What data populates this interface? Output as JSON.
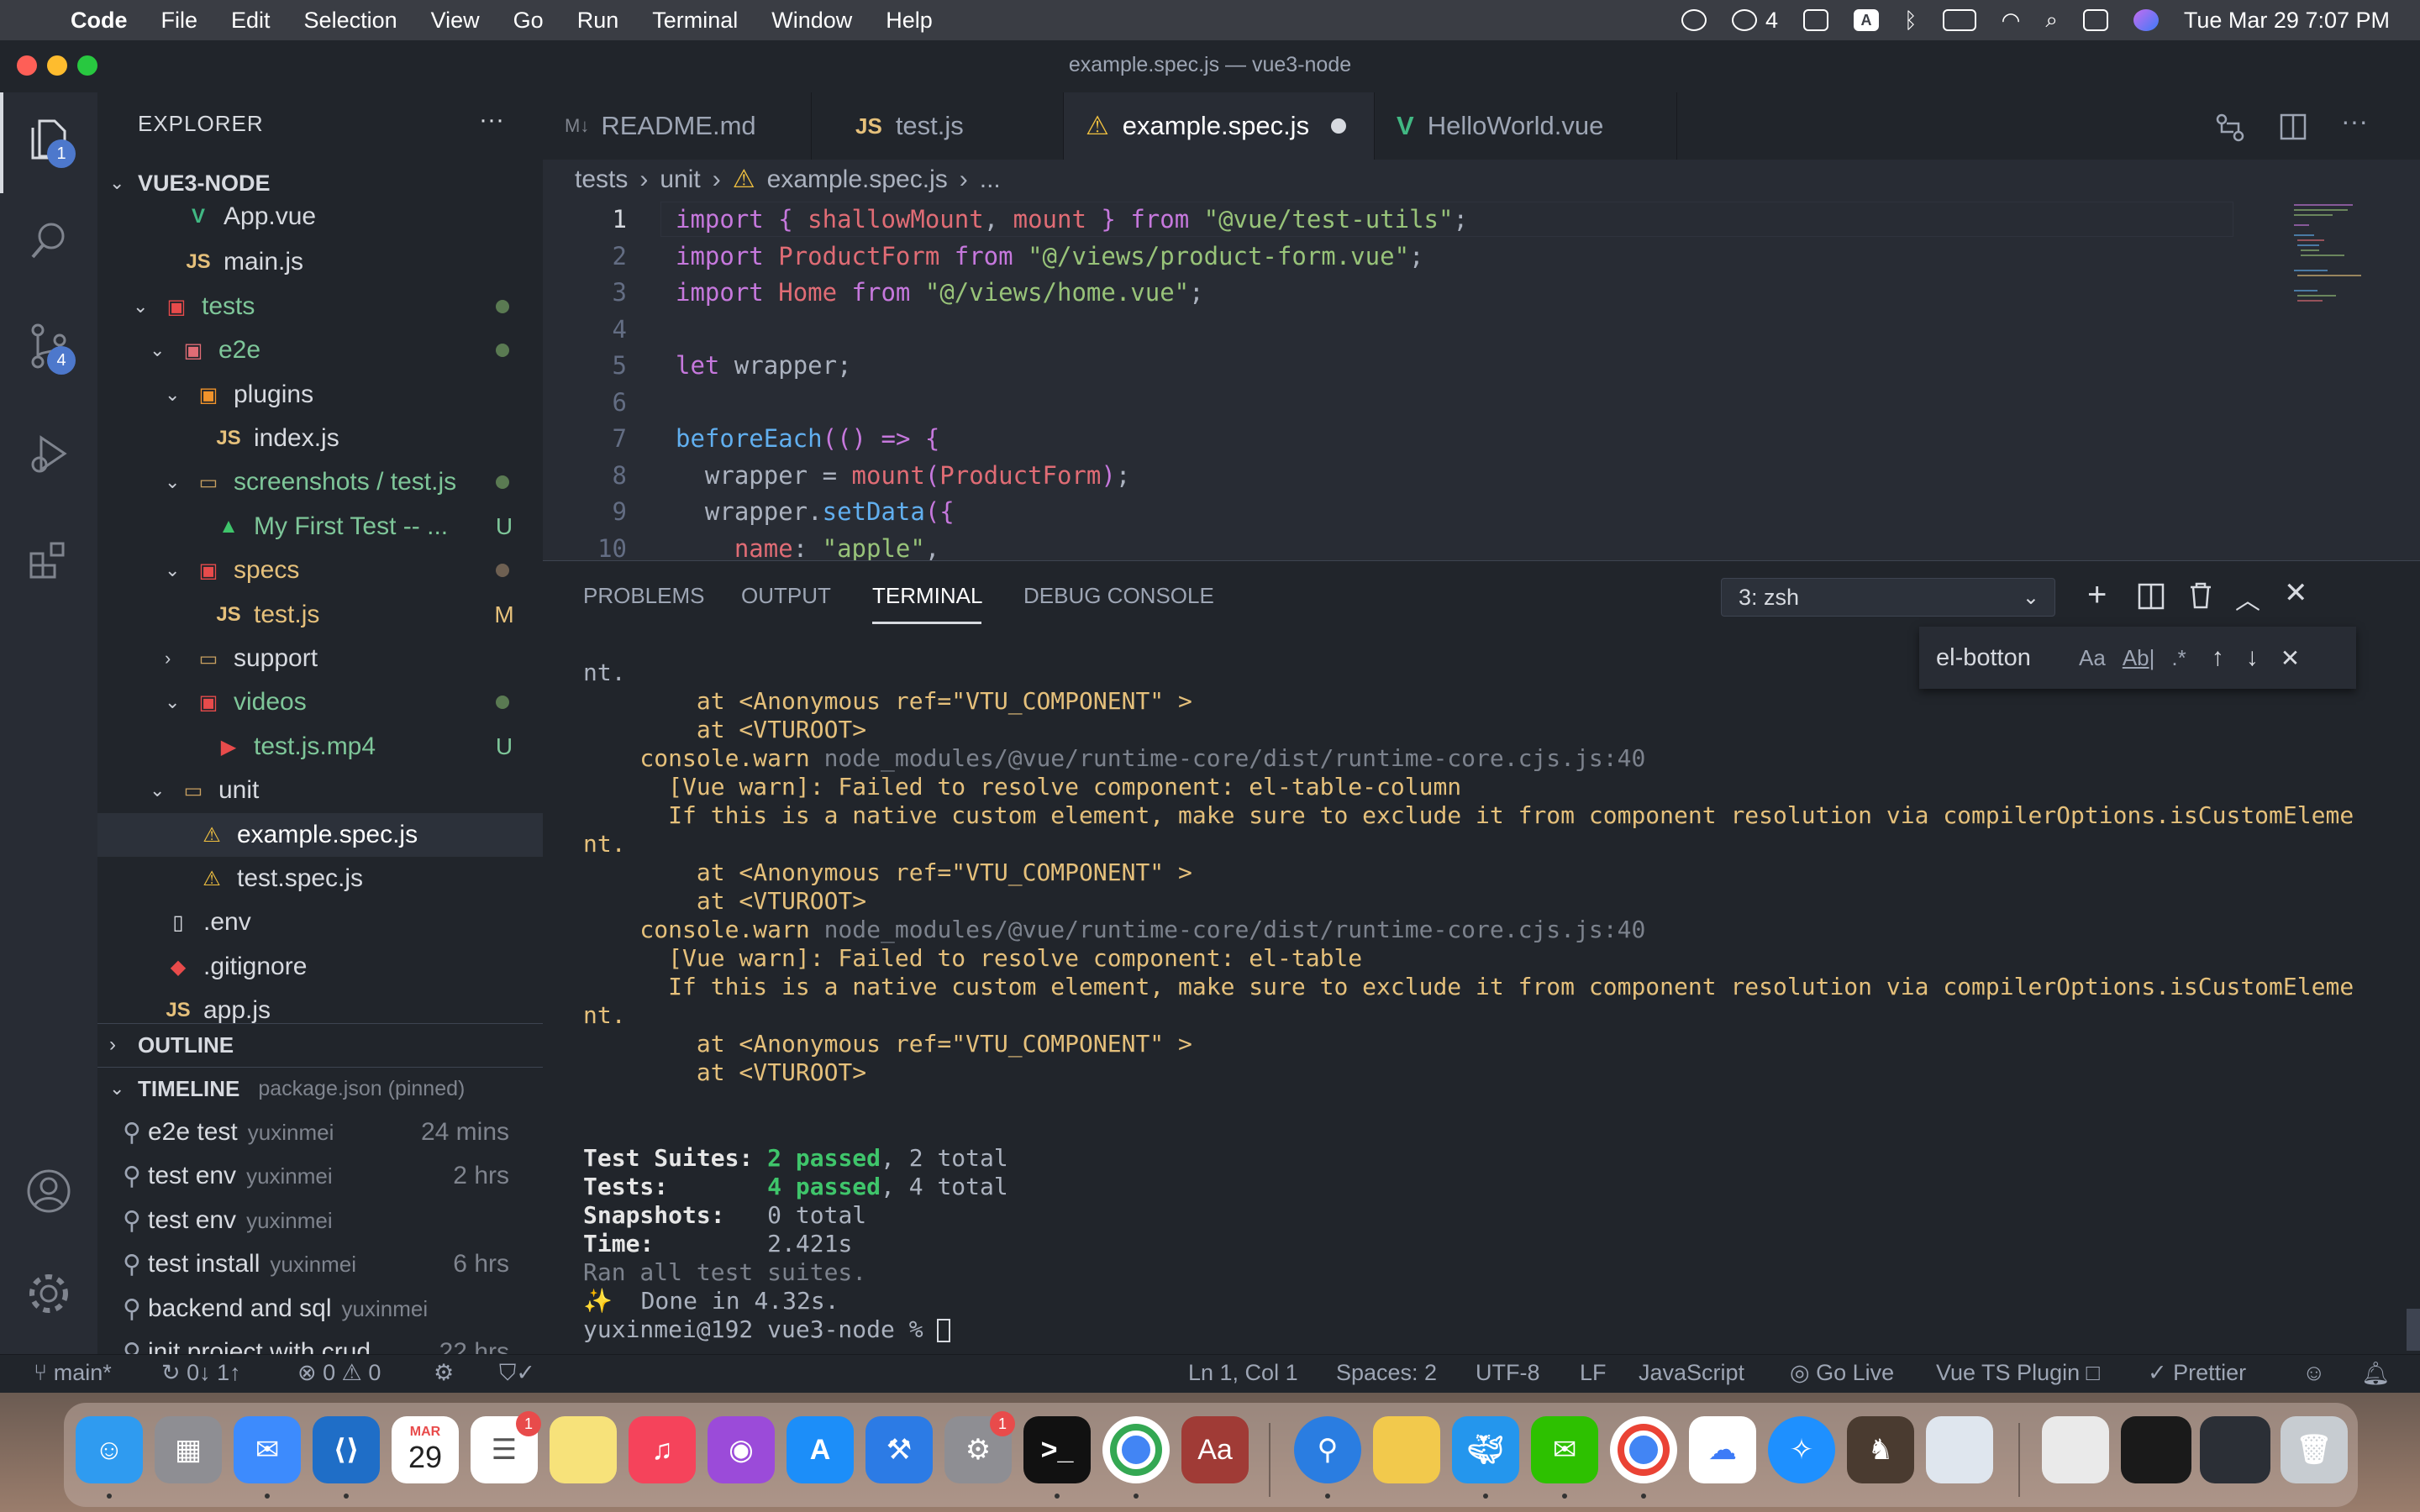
{
  "menubar": {
    "app": "Code",
    "items": [
      "File",
      "Edit",
      "Selection",
      "View",
      "Go",
      "Run",
      "Terminal",
      "Window",
      "Help"
    ],
    "wechat_count": "4",
    "input_source": "A",
    "datetime": "Tue Mar 29  7:07 PM"
  },
  "window": {
    "title": "example.spec.js — vue3-node"
  },
  "activity": {
    "explorer_badge": "1",
    "scm_badge": "4"
  },
  "sidebar": {
    "title": "EXPLORER",
    "more": "···",
    "project": "VUE3-NODE",
    "rows": [
      {
        "name": "App.vue",
        "icon": "V",
        "status": ""
      },
      {
        "name": "main.js",
        "icon": "JS",
        "status": ""
      },
      {
        "name": "tests",
        "icon": "▣",
        "status": "●"
      },
      {
        "name": "e2e",
        "icon": "▣",
        "status": "●"
      },
      {
        "name": "plugins",
        "icon": "▣",
        "status": ""
      },
      {
        "name": "index.js",
        "icon": "JS",
        "status": ""
      },
      {
        "name": "screenshots / test.js",
        "icon": "▭",
        "status": "●"
      },
      {
        "name": "My First Test -- ...",
        "icon": "▲",
        "status": "U"
      },
      {
        "name": "specs",
        "icon": "▣",
        "status": "●"
      },
      {
        "name": "test.js",
        "icon": "JS",
        "status": "M"
      },
      {
        "name": "support",
        "icon": "▭",
        "status": ""
      },
      {
        "name": "videos",
        "icon": "▣",
        "status": "●"
      },
      {
        "name": "test.js.mp4",
        "icon": "▶",
        "status": "U"
      },
      {
        "name": "unit",
        "icon": "▭",
        "status": ""
      },
      {
        "name": "example.spec.js",
        "icon": "⚠",
        "status": ""
      },
      {
        "name": "test.spec.js",
        "icon": "⚠",
        "status": ""
      },
      {
        "name": ".env",
        "icon": "▯",
        "status": ""
      },
      {
        "name": ".gitignore",
        "icon": "◆",
        "status": ""
      },
      {
        "name": "app.js",
        "icon": "JS",
        "status": ""
      }
    ],
    "outline": "OUTLINE",
    "timeline": "TIMELINE",
    "timeline_pin": "package.json (pinned)",
    "timeline_items": [
      {
        "msg": "e2e test",
        "author": "yuxinmei",
        "time": "24 mins"
      },
      {
        "msg": "test env",
        "author": "yuxinmei",
        "time": "2 hrs"
      },
      {
        "msg": "test env",
        "author": "yuxinmei",
        "time": ""
      },
      {
        "msg": "test install",
        "author": "yuxinmei",
        "time": "6 hrs"
      },
      {
        "msg": "backend and sql",
        "author": "yuxinmei",
        "time": ""
      },
      {
        "msg": "init project with crud",
        "author": "",
        "time": "22 hrs"
      }
    ]
  },
  "tabs": [
    {
      "label": "README.md",
      "icon": "M↓"
    },
    {
      "label": "test.js",
      "icon": "JS"
    },
    {
      "label": "example.spec.js",
      "icon": "⚠"
    },
    {
      "label": "HelloWorld.vue",
      "icon": "V"
    }
  ],
  "breadcrumb": [
    "tests",
    "unit",
    "example.spec.js",
    "..."
  ],
  "editor": {
    "line_numbers": [
      "1",
      "2",
      "3",
      "4",
      "5",
      "6",
      "7",
      "8",
      "9",
      "10"
    ],
    "lines": [
      "import { shallowMount, mount } from \"@vue/test-utils\";",
      "import ProductForm from \"@/views/product-form.vue\";",
      "import Home from \"@/views/home.vue\";",
      "",
      "let wrapper;",
      "",
      "beforeEach(() => {",
      "  wrapper = mount(ProductForm);",
      "  wrapper.setData({",
      "    name: \"apple\","
    ]
  },
  "panel": {
    "tabs": [
      "PROBLEMS",
      "OUTPUT",
      "TERMINAL",
      "DEBUG CONSOLE"
    ],
    "terminal_select": "3: zsh",
    "find_value": "el-botton",
    "find_opts": [
      "Aa",
      "Ab|",
      ".*"
    ],
    "terminal": {
      "l1": "nt.",
      "l2": "        at <Anonymous ref=\"VTU_COMPONENT\" >",
      "l3": "        at <VTUROOT>",
      "l4a": "    console.warn ",
      "l4b": "node_modules/@vue/runtime-core/dist/runtime-core.cjs.js:40",
      "l5": "      [Vue warn]: Failed to resolve component: el-table-column",
      "l6": "      If this is a native custom element, make sure to exclude it from component resolution via compilerOptions.isCustomEleme",
      "l7": "nt.",
      "l8": "        at <Anonymous ref=\"VTU_COMPONENT\" >",
      "l9": "        at <VTUROOT>",
      "l10a": "    console.warn ",
      "l10b": "node_modules/@vue/runtime-core/dist/runtime-core.cjs.js:40",
      "l11": "      [Vue warn]: Failed to resolve component: el-table",
      "l12": "      If this is a native custom element, make sure to exclude it from component resolution via compilerOptions.isCustomEleme",
      "l13": "nt.",
      "l14": "        at <Anonymous ref=\"VTU_COMPONENT\" >",
      "l15": "        at <VTUROOT>",
      "suites_label": "Test Suites: ",
      "suites_pass": "2 passed",
      "suites_total": ", 2 total",
      "tests_label": "Tests:       ",
      "tests_pass": "4 passed",
      "tests_total": ", 4 total",
      "snap_label": "Snapshots:   ",
      "snap_val": "0 total",
      "time_label": "Time:        ",
      "time_val": "2.421s",
      "ran": "Ran all test suites.",
      "done": "✨  Done in 4.32s.",
      "prompt": "yuxinmei@192 vue3-node % "
    }
  },
  "statusbar": {
    "branch": "main*",
    "sync": "0↓ 1↑",
    "problems": "⊗ 0 ⚠ 0",
    "position": "Ln 1, Col 1",
    "spaces": "Spaces: 2",
    "encoding": "UTF-8",
    "eol": "LF",
    "language": "JavaScript",
    "golive": "Go Live",
    "vuets": "Vue TS Plugin □",
    "prettier": "✓ Prettier"
  },
  "dock": {
    "calendar_month": "MAR",
    "calendar_day": "29",
    "reminders_badge": "1",
    "settings_badge": "1",
    "dictionary": "Aa"
  }
}
